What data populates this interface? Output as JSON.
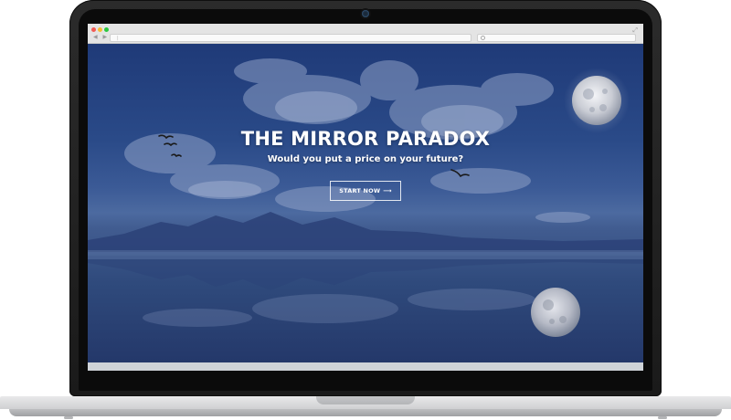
{
  "browser": {
    "nav_arrows": "◀ ▶",
    "url_cursor": "|",
    "expand_glyph": "⤢"
  },
  "hero": {
    "title": "THE MIRROR PARADOX",
    "subtitle": "Would you put a price on your future?",
    "cta_label": "START NOW",
    "cta_arrow": "⟶"
  },
  "colors": {
    "overlay_blue": "#1f3460",
    "text": "#ffffff",
    "browser_chrome": "#e4e4e4"
  },
  "icons": {
    "browser_close": "red-dot-icon",
    "browser_minimize": "yellow-dot-icon",
    "browser_maximize": "green-dot-icon",
    "search": "search-icon",
    "expand": "expand-icon",
    "cta_arrow": "arrow-right-icon",
    "moon": "moon-icon",
    "birds": "bird-icon"
  }
}
